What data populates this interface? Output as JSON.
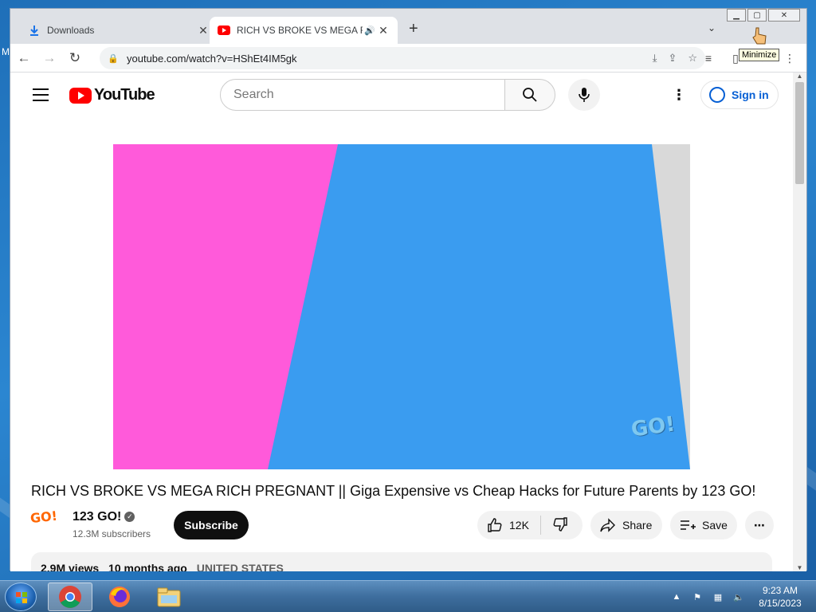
{
  "browser": {
    "tabs": [
      {
        "title": "Downloads",
        "icon": "download-icon",
        "close": "✕"
      },
      {
        "title": "RICH VS BROKE VS MEGA RICH PREGNANT || Giga Expensive vs Cheap Hacks",
        "icon": "youtube-icon",
        "close": "✕"
      }
    ],
    "new_tab": "+",
    "url": "youtube.com/watch?v=HShEt4IM5gk",
    "tooltip": "Minimize"
  },
  "youtube": {
    "logo_text": "YouTube",
    "search_placeholder": "Search",
    "sign_in": "Sign in",
    "video_title": "RICH VS BROKE VS MEGA RICH PREGNANT || Giga Expensive vs Cheap Hacks for Future Parents by 123 GO!",
    "watermark": "GO!",
    "channel": {
      "name": "123 GO!",
      "subscribers": "12.3M subscribers",
      "avatar_text": "GO!"
    },
    "subscribe": "Subscribe",
    "likes": "12K",
    "share": "Share",
    "save": "Save",
    "description": {
      "views": "2.9M views",
      "age": "10 months ago",
      "location": "UNITED STATES"
    }
  },
  "taskbar": {
    "time": "9:23 AM",
    "date": "8/15/2023"
  },
  "colors": {
    "youtube_red": "#ff0000",
    "link_blue": "#065fd4",
    "video_pink": "#ff5ada",
    "video_blue": "#3a9cf0"
  }
}
